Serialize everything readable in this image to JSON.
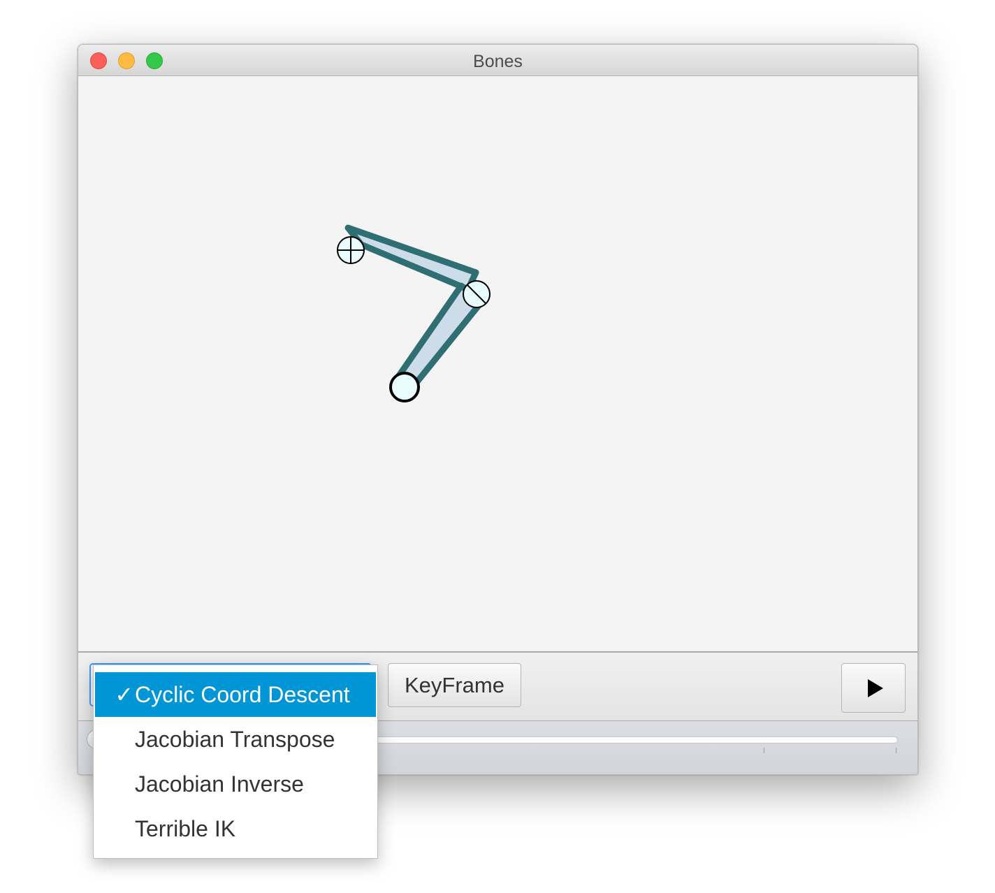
{
  "window": {
    "title": "Bones"
  },
  "toolbar": {
    "algorithm_select": {
      "selected": "Cyclic Coord Descent"
    },
    "keyframe_label": "KeyFrame",
    "play_icon": "play-icon"
  },
  "dropdown": {
    "check_mark": "✓",
    "options": [
      {
        "label": "Cyclic Coord Descent",
        "selected": true
      },
      {
        "label": "Jacobian Transpose",
        "selected": false
      },
      {
        "label": "Jacobian Inverse",
        "selected": false
      },
      {
        "label": "Terrible IK",
        "selected": false
      }
    ]
  },
  "timeline": {
    "position": 0.0
  },
  "colors": {
    "bone_stroke": "#2f6e73",
    "bone_fill": "#ccdce9",
    "joint_fill": "#e8fbfd",
    "selection": "#0096d6",
    "focus_ring": "#3b99fc"
  }
}
